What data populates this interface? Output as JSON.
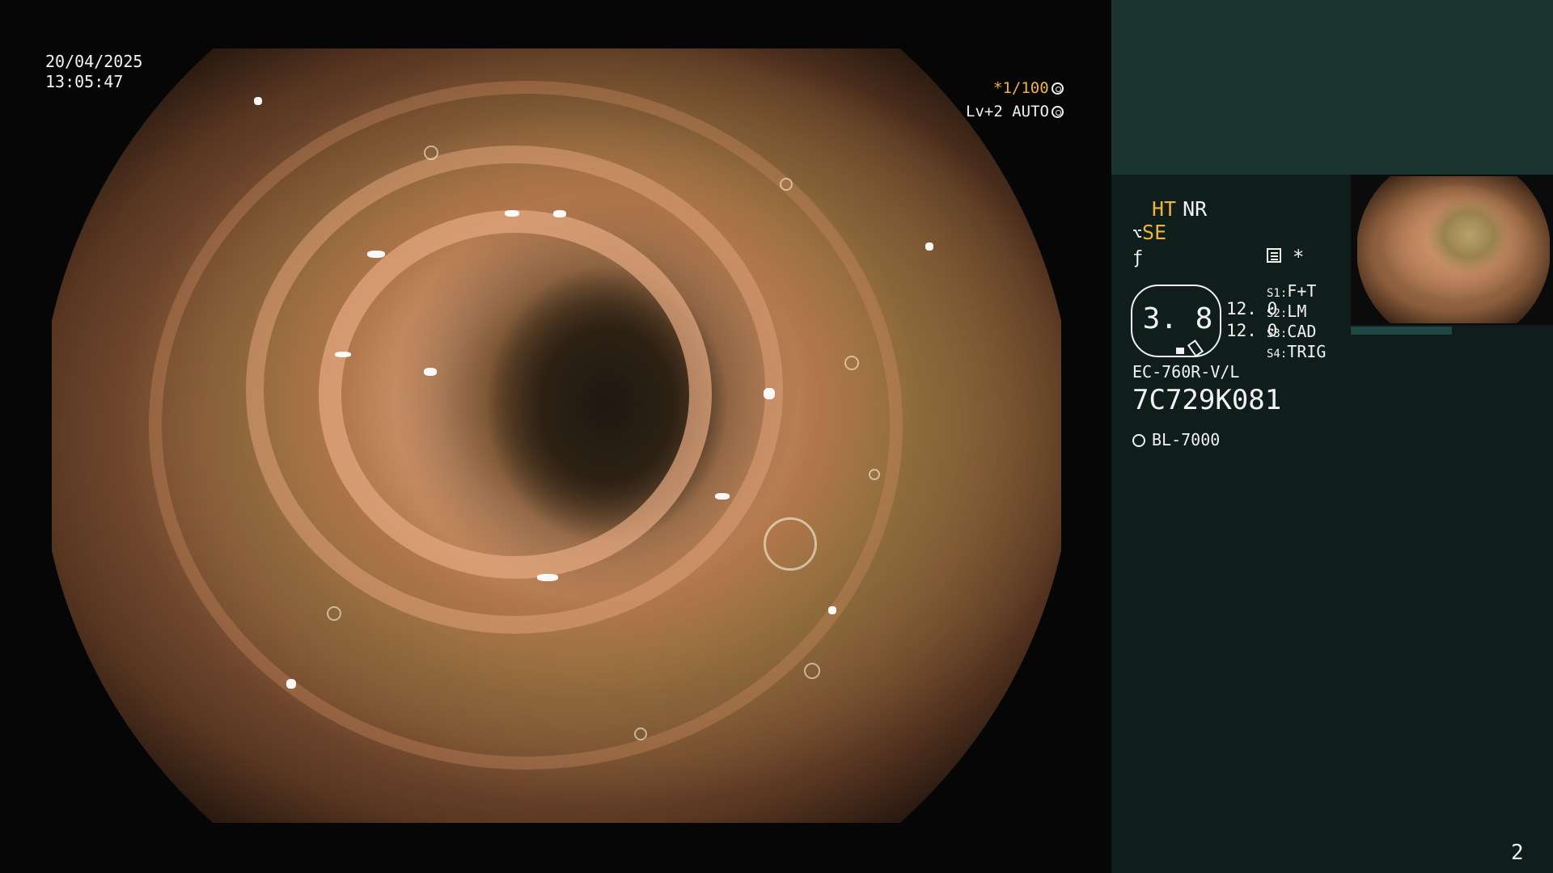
{
  "osd": {
    "date": "20/04/2025",
    "time": "13:05:47",
    "shutter": "*1/100",
    "level": "Lv+2 AUTO"
  },
  "panel": {
    "mode_ht": "HT",
    "mode_nr": "NR",
    "mode_se": "SE",
    "star": "*",
    "gauge_value": "3. 8",
    "value_a": "12. 0",
    "value_b": "12. 0",
    "switches": [
      {
        "key": "S1:",
        "value": "F+T"
      },
      {
        "key": "S2:",
        "value": "LM"
      },
      {
        "key": "S3:",
        "value": "CAD"
      },
      {
        "key": "S4:",
        "value": "TRIG"
      }
    ],
    "scope_model": "EC-760R-V/L",
    "scope_serial": "7C729K081",
    "light_source": "BL-7000",
    "page_number": "2"
  },
  "icons": {
    "shutter_icon": "aperture-icon",
    "level_icon": "ring-icon",
    "light_icon": "sun-icon",
    "lens_icon": "lens-icon",
    "list_icon": "list-icon"
  }
}
